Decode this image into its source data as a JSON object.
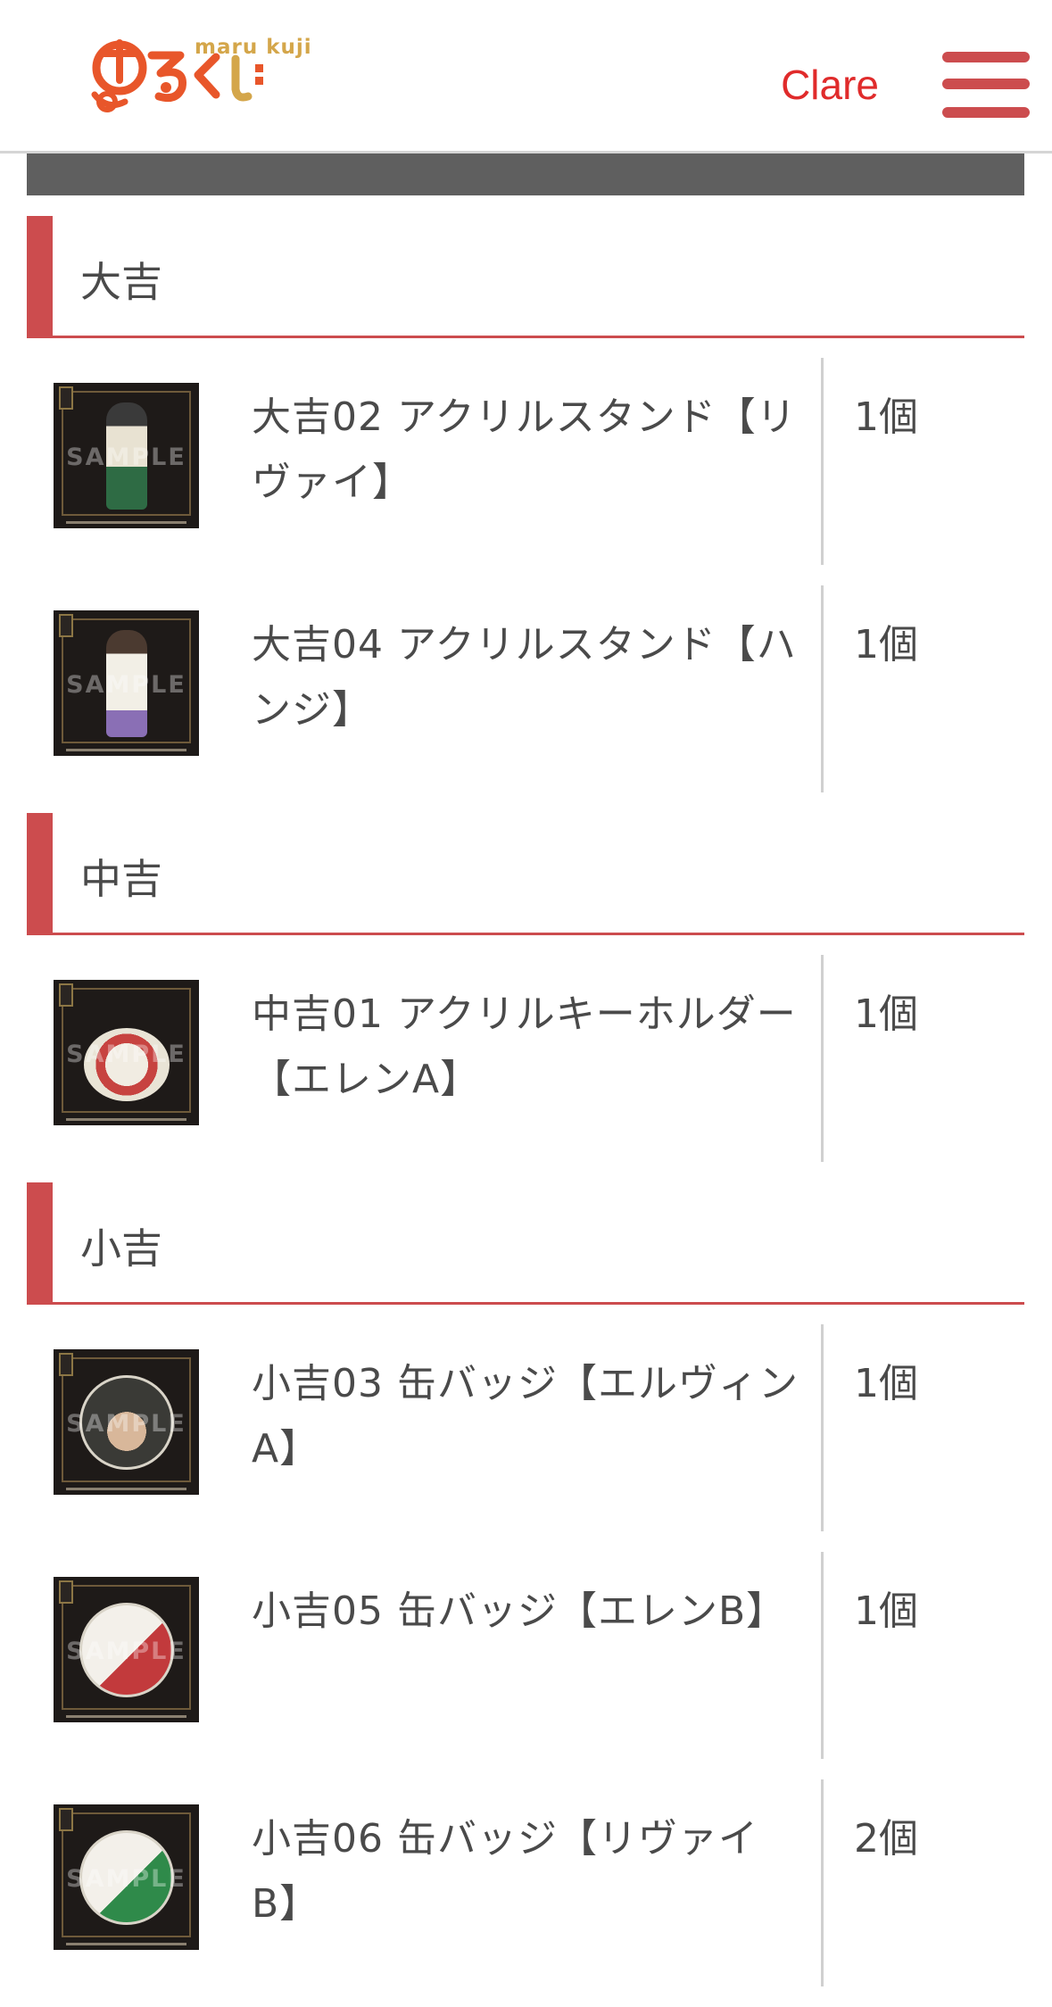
{
  "header": {
    "logo_text": "まるくじ",
    "logo_subtext": "maru kuji",
    "user_name": "Clare"
  },
  "colors": {
    "accent": "#cc4c4e",
    "user_name": "#e02b2b",
    "text": "#4a4a4a",
    "logo_orange": "#e8562a",
    "logo_gold": "#d4a64a"
  },
  "sections": [
    {
      "title": "大吉",
      "items": [
        {
          "name": "大吉02 アクリルスタンド【リヴァイ】",
          "qty": "1個",
          "sample": "SAMPLE"
        },
        {
          "name": "大吉04 アクリルスタンド【ハンジ】",
          "qty": "1個",
          "sample": "SAMPLE"
        }
      ]
    },
    {
      "title": "中吉",
      "items": [
        {
          "name": "中吉01 アクリルキーホルダー【エレンA】",
          "qty": "1個",
          "sample": "SAMPLE"
        }
      ]
    },
    {
      "title": "小吉",
      "items": [
        {
          "name": "小吉03 缶バッジ【エルヴィンA】",
          "qty": "1個",
          "sample": "SAMPLE"
        },
        {
          "name": "小吉05 缶バッジ【エレンB】",
          "qty": "1個",
          "sample": "SAMPLE"
        },
        {
          "name": "小吉06 缶バッジ【リヴァイB】",
          "qty": "2個",
          "sample": "SAMPLE"
        }
      ]
    }
  ]
}
